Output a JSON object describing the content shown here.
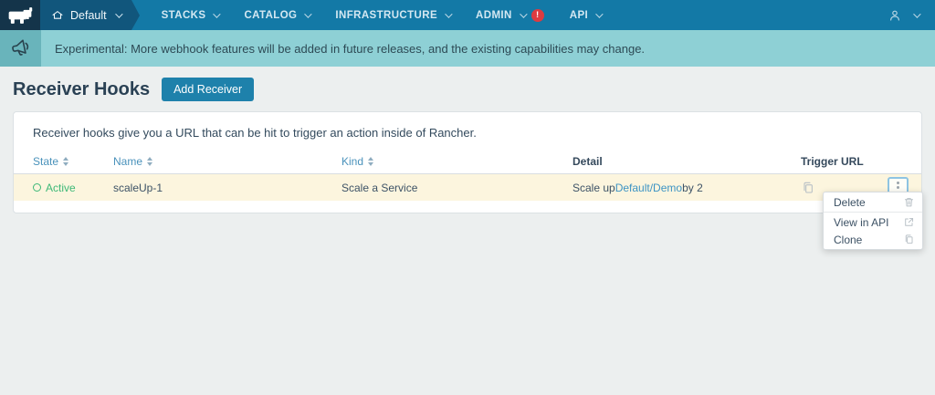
{
  "nav": {
    "environment": {
      "label": "Default"
    },
    "items": [
      {
        "label": "STACKS"
      },
      {
        "label": "CATALOG"
      },
      {
        "label": "INFRASTRUCTURE"
      },
      {
        "label": "ADMIN",
        "badge": "!"
      },
      {
        "label": "API"
      }
    ]
  },
  "banner": {
    "text": "Experimental: More webhook features will be added in future releases, and the existing capabilities may change."
  },
  "page": {
    "title": "Receiver Hooks",
    "add_button": "Add Receiver"
  },
  "card": {
    "description": "Receiver hooks give you a URL that can be hit to trigger an action inside of Rancher."
  },
  "table": {
    "headers": {
      "state": "State",
      "name": "Name",
      "kind": "Kind",
      "detail": "Detail",
      "trigger_url": "Trigger URL"
    },
    "row": {
      "state": "Active",
      "name": "scaleUp-1",
      "kind": "Scale a Service",
      "detail_prefix": "Scale up ",
      "detail_link": "Default/Demo",
      "detail_suffix": " by 2"
    }
  },
  "context_menu": {
    "items": [
      {
        "label": "Delete",
        "icon": "trash-icon"
      },
      {
        "label": "View in API",
        "icon": "external-link-icon"
      },
      {
        "label": "Clone",
        "icon": "copy-icon"
      }
    ]
  },
  "colors": {
    "nav_bg": "#1379a6",
    "nav_env_bg": "#11567c",
    "nav_logo_bg": "#14344a",
    "banner_bg": "#8ed0d5",
    "banner_icon_bg": "#69b4bb",
    "accent_blue": "#1e81ab",
    "link_blue": "#3d94c4",
    "sortable_header_blue": "#4a92bb",
    "active_green": "#3db877",
    "row_highlight": "#fcf5de",
    "badge_red": "#dd3b41"
  }
}
